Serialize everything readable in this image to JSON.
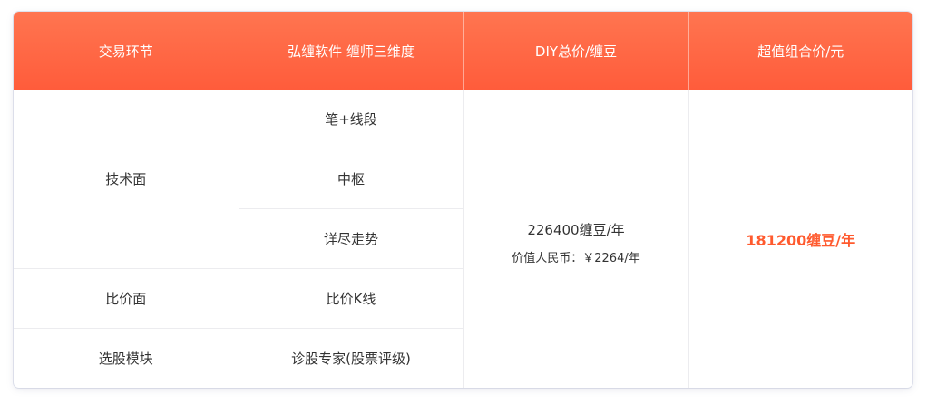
{
  "table": {
    "headers": [
      "交易环节",
      "弘缠软件  缠师三维度",
      "DIY总价/缠豆",
      "超值组合价/元"
    ],
    "sections": [
      {
        "name": "技术面",
        "items": [
          "笔+线段",
          "中枢",
          "详尽走势"
        ]
      },
      {
        "name": "比价面",
        "items": [
          "比价K线"
        ]
      },
      {
        "name": "选股模块",
        "items": [
          "诊股专家(股票评级)"
        ]
      }
    ],
    "diy_price": "226400缠豆/年",
    "diy_rmb": "价值人民币：￥2264/年",
    "combo_price": "181200缠豆/年"
  },
  "colors": {
    "header_gradient_top": "#ff7550",
    "header_gradient_bottom": "#ff5c3b",
    "combo_price_color": "#ff5a2e",
    "text": "#333333",
    "grid": "#ececef"
  }
}
